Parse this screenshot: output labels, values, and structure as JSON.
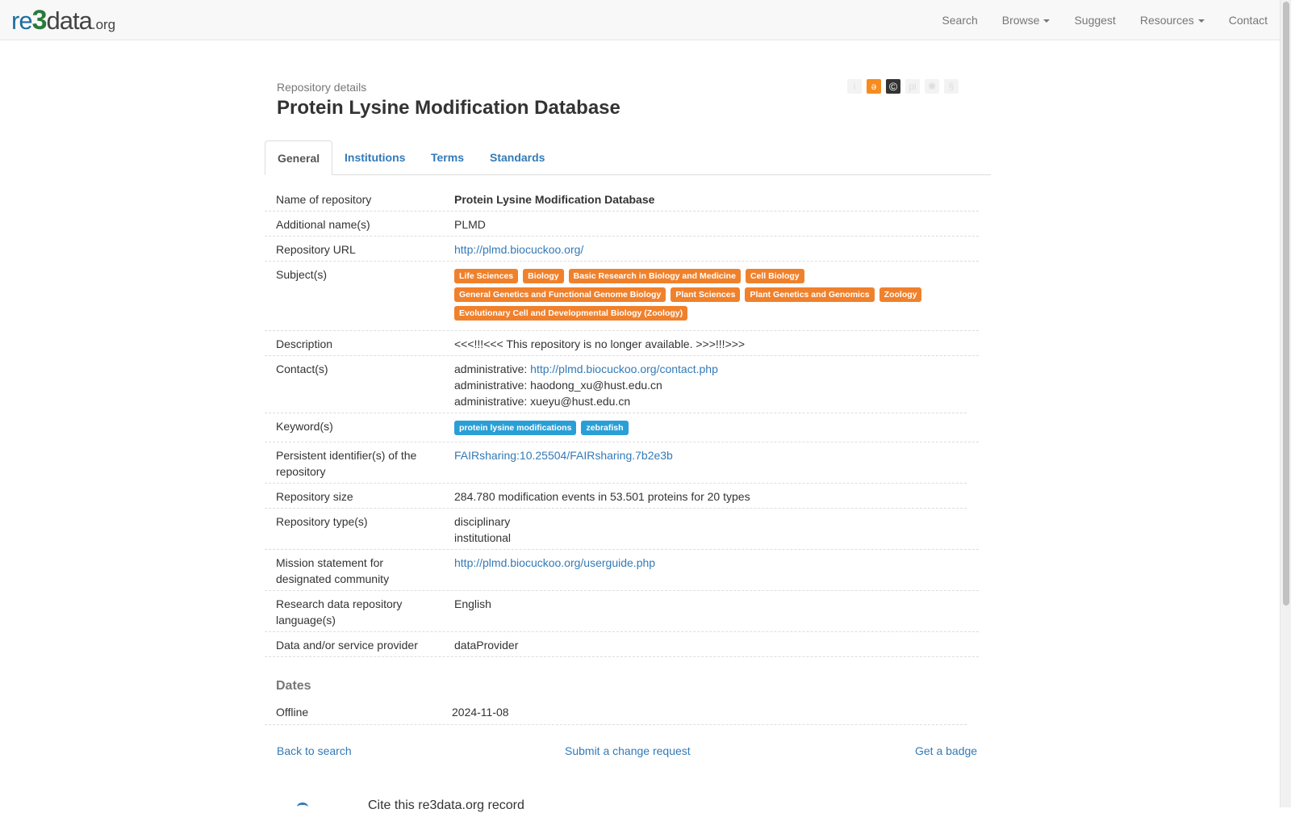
{
  "brand": {
    "re": "re",
    "three": "3",
    "data": "data",
    "org": ".org"
  },
  "nav": {
    "search": "Search",
    "browse": "Browse",
    "suggest": "Suggest",
    "resources": "Resources",
    "contact": "Contact"
  },
  "header": {
    "subtitle": "Repository details",
    "title": "Protein Lysine Modification Database",
    "icons": [
      "info-icon",
      "open-access-icon",
      "copyright-icon",
      "pid-icon",
      "certificate-icon",
      "policy-icon"
    ],
    "icon_glyphs": {
      "info": "i",
      "open_access": "ə",
      "copyright": "©",
      "pid": "pi",
      "certificate": "✺",
      "policy": "§"
    }
  },
  "tabs": [
    "General",
    "Institutions",
    "Terms",
    "Standards"
  ],
  "rows": {
    "name": {
      "label": "Name of repository",
      "value": "Protein Lysine Modification Database"
    },
    "additional": {
      "label": "Additional name(s)",
      "value": "PLMD"
    },
    "url": {
      "label": "Repository URL",
      "value": "http://plmd.biocuckoo.org/"
    },
    "subjects": {
      "label": "Subject(s)",
      "tags": [
        "Life Sciences",
        "Biology",
        "Basic Research in Biology and Medicine",
        "Cell Biology",
        "General Genetics and Functional Genome Biology",
        "Plant Sciences",
        "Plant Genetics and Genomics",
        "Zoology",
        "Evolutionary Cell and Developmental Biology (Zoology)"
      ]
    },
    "description": {
      "label": "Description",
      "value": "<<<!!!<<< This repository is no longer available. >>>!!!>>>"
    },
    "contacts": {
      "label": "Contact(s)",
      "prefix": "administrative: ",
      "c1": "http://plmd.biocuckoo.org/contact.php",
      "c2": "haodong_xu@hust.edu.cn",
      "c3": "xueyu@hust.edu.cn"
    },
    "keywords": {
      "label": "Keyword(s)",
      "tags": [
        "protein lysine modifications",
        "zebrafish"
      ]
    },
    "pid": {
      "label": "Persistent identifier(s) of the repository",
      "value": "FAIRsharing:10.25504/FAIRsharing.7b2e3b"
    },
    "size": {
      "label": "Repository size",
      "value": "284.780 modification events in 53.501 proteins for 20 types"
    },
    "types": {
      "label": "Repository type(s)",
      "v1": "disciplinary",
      "v2": "institutional"
    },
    "mission": {
      "label": "Mission statement for designated community",
      "value": "http://plmd.biocuckoo.org/userguide.php"
    },
    "language": {
      "label": "Research data repository language(s)",
      "value": "English"
    },
    "provider": {
      "label": "Data and/or service provider",
      "value": "dataProvider"
    }
  },
  "dates": {
    "title": "Dates",
    "offline_label": "Offline",
    "offline_value": "2024-11-08"
  },
  "footer": {
    "back": "Back to search",
    "change": "Submit a change request",
    "badge": "Get a badge"
  },
  "cutoff_text": "Cite this re3data.org record"
}
